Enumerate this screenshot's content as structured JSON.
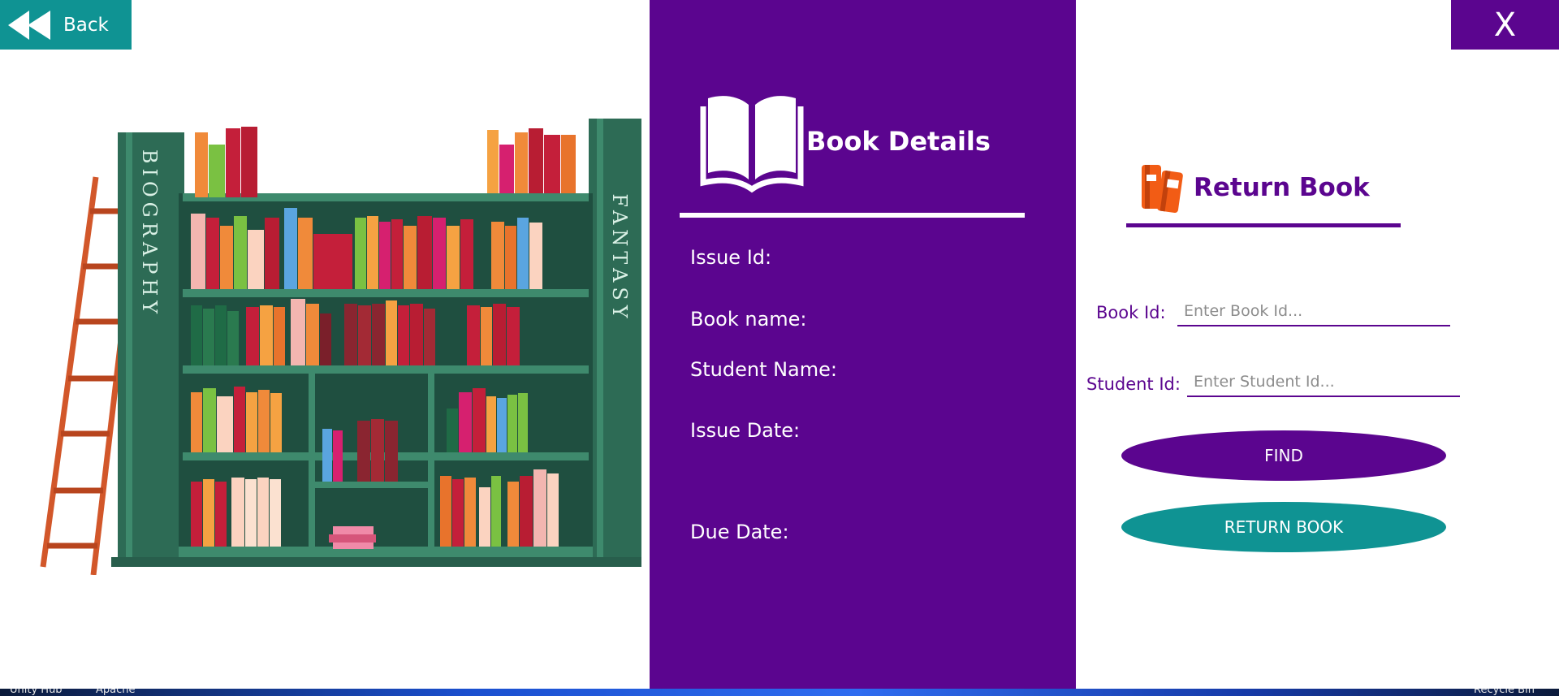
{
  "header": {
    "back_label": "Back",
    "close_label": "X"
  },
  "illustration": {
    "left_sign": "BIOGRAPHY",
    "right_sign": "FANTASY"
  },
  "details": {
    "title": "Book Details",
    "fields": [
      "Issue Id:",
      "Book name:",
      "Student Name:",
      "Issue Date:",
      "Due Date:"
    ]
  },
  "return_form": {
    "title": "Return Book",
    "book_id_label": "Book Id:",
    "book_id_placeholder": "Enter Book Id...",
    "book_id_value": "",
    "student_id_label": "Student Id:",
    "student_id_placeholder": "Enter Student Id...",
    "student_id_value": "",
    "find_label": "FIND",
    "return_label": "RETURN BOOK"
  },
  "taskbar": {
    "items": [
      "Unity Hub",
      "Apache",
      "Recycle Bin"
    ]
  },
  "colors": {
    "teal": "#0f9393",
    "purple": "#5b058f",
    "white": "#ffffff",
    "return_icon": "#f25c15"
  },
  "icons": {
    "back": "rewind-icon",
    "details": "open-book-icon",
    "return": "books-icon"
  }
}
